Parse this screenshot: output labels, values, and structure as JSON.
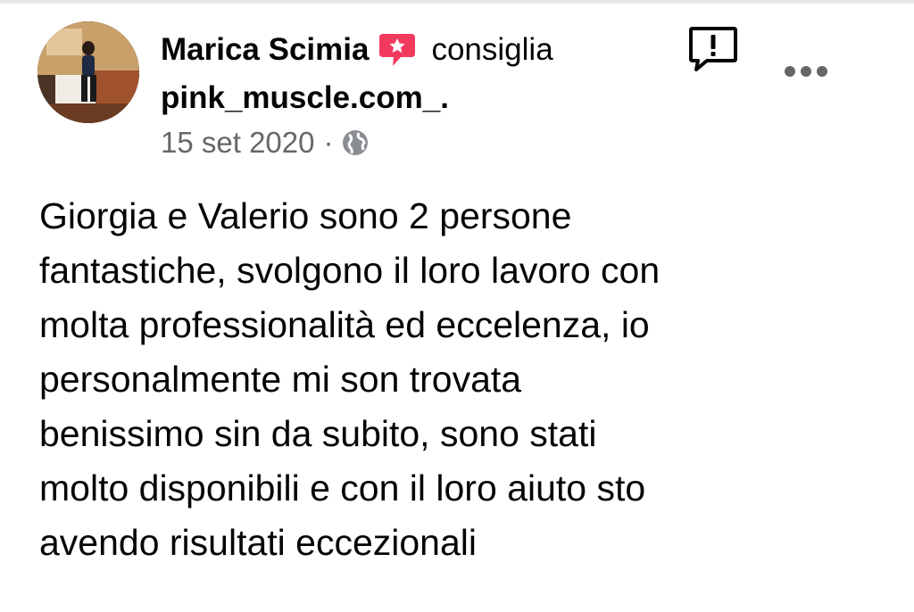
{
  "post": {
    "author_name": "Marica Scimia",
    "action": "consiglia",
    "page_name": "pink_muscle.com_.",
    "date": "15 set 2020",
    "separator": "·",
    "privacy_icon": "globe-icon",
    "recommend_icon": "recommend-star-icon",
    "report_icon": "report-flag-icon",
    "more_icon": "more-options-icon",
    "text": "Giorgia e Valerio  sono 2 persone\nfantastiche, svolgono il loro lavoro con\nmolta professionalità ed eccelenza, io\npersonalmente mi son trovata\nbenissimo sin da subito, sono stati\nmolto disponibili  e con il loro aiuto sto\navendo risultati  eccezionali"
  },
  "colors": {
    "recommend_badge": "#f23a5f",
    "meta_text": "#65676b",
    "icon_gray": "#65676b",
    "text": "#050505"
  }
}
